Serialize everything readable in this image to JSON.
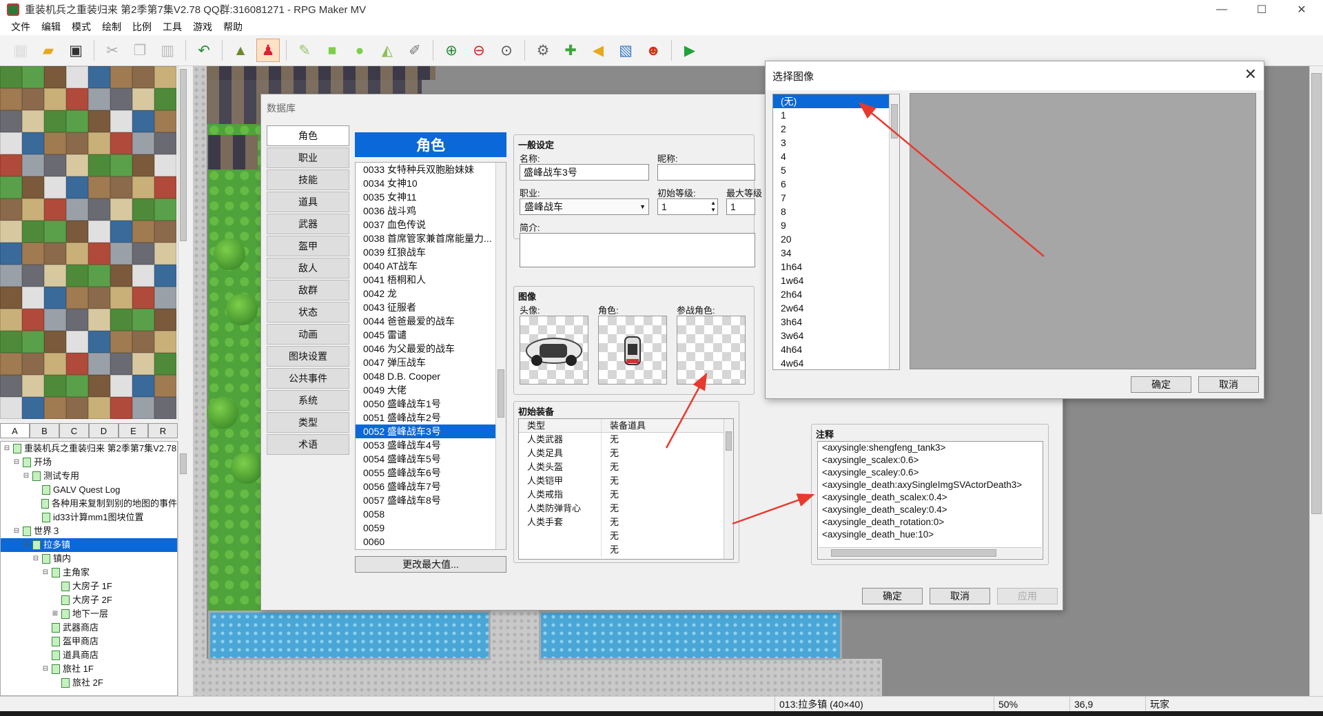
{
  "window": {
    "title": "重装机兵之重装归来 第2季第7集V2.78 QQ群:316081271 - RPG Maker MV"
  },
  "menu": [
    "文件",
    "编辑",
    "模式",
    "绘制",
    "比例",
    "工具",
    "游戏",
    "帮助"
  ],
  "toolbar": {
    "icons": [
      "new-file-icon",
      "open-folder-icon",
      "save-icon",
      "cut-icon",
      "copy-icon",
      "paste-icon",
      "undo-icon",
      "map-layer-icon",
      "event-layer-icon",
      "pencil-icon",
      "rectangle-icon",
      "ellipse-icon",
      "fill-icon",
      "shadow-pen-icon",
      "zoom-in-icon",
      "zoom-out-icon",
      "zoom-actual-icon",
      "database-icon",
      "plugin-icon",
      "sound-icon",
      "resource-icon",
      "character-generator-icon",
      "playtest-icon"
    ]
  },
  "tile_tabs": [
    "A",
    "B",
    "C",
    "D",
    "E",
    "R"
  ],
  "map_tree": [
    {
      "label": "重装机兵之重装归来 第2季第7集V2.78",
      "indent": 0,
      "exp": "⊟"
    },
    {
      "label": "开场",
      "indent": 1,
      "exp": "⊟"
    },
    {
      "label": "测试专用",
      "indent": 2,
      "exp": "⊟"
    },
    {
      "label": "GALV Quest Log",
      "indent": 3,
      "exp": ""
    },
    {
      "label": "各种用来复制到别的地图的事件",
      "indent": 3,
      "exp": ""
    },
    {
      "label": "id33计算mm1图块位置",
      "indent": 3,
      "exp": ""
    },
    {
      "label": "世界３",
      "indent": 1,
      "exp": "⊟"
    },
    {
      "label": "拉多镇",
      "indent": 2,
      "exp": "⊟",
      "selected": true
    },
    {
      "label": "镇内",
      "indent": 3,
      "exp": "⊟"
    },
    {
      "label": "主角家",
      "indent": 4,
      "exp": "⊟"
    },
    {
      "label": "大房子 1F",
      "indent": 5,
      "exp": ""
    },
    {
      "label": "大房子 2F",
      "indent": 5,
      "exp": ""
    },
    {
      "label": "地下一层",
      "indent": 5,
      "exp": "⊞"
    },
    {
      "label": "武器商店",
      "indent": 4,
      "exp": ""
    },
    {
      "label": "盔甲商店",
      "indent": 4,
      "exp": ""
    },
    {
      "label": "道具商店",
      "indent": 4,
      "exp": ""
    },
    {
      "label": "旅社 1F",
      "indent": 4,
      "exp": "⊟"
    },
    {
      "label": "旅社 2F",
      "indent": 5,
      "exp": ""
    }
  ],
  "database": {
    "title": "数据库",
    "categories": [
      "角色",
      "职业",
      "技能",
      "道具",
      "武器",
      "盔甲",
      "敌人",
      "敌群",
      "状态",
      "动画",
      "图块设置",
      "公共事件",
      "系统",
      "类型",
      "术语"
    ],
    "list_header": "角色",
    "actors": [
      {
        "label": "0033 女特种兵双胞胎妹妹"
      },
      {
        "label": "0034 女神10"
      },
      {
        "label": "0035 女神11"
      },
      {
        "label": "0036 战斗鸡"
      },
      {
        "label": "0037 血色传说"
      },
      {
        "label": "0038 首席管家兼首席能量力..."
      },
      {
        "label": "0039 红狼战车"
      },
      {
        "label": "0040 AT战车"
      },
      {
        "label": "0041 梧桐和人"
      },
      {
        "label": "0042 龙"
      },
      {
        "label": "0043 征服者"
      },
      {
        "label": "0044 爸爸最爱的战车"
      },
      {
        "label": "0045 雷谴"
      },
      {
        "label": "0046 为父最爱的战车"
      },
      {
        "label": "0047 弹压战车"
      },
      {
        "label": "0048 D.B. Cooper"
      },
      {
        "label": "0049 大佬"
      },
      {
        "label": "0050 盛峰战车1号"
      },
      {
        "label": "0051 盛峰战车2号"
      },
      {
        "label": "0052 盛峰战车3号",
        "selected": true
      },
      {
        "label": "0053 盛峰战车4号"
      },
      {
        "label": "0054 盛峰战车5号"
      },
      {
        "label": "0055 盛峰战车6号"
      },
      {
        "label": "0056 盛峰战车7号"
      },
      {
        "label": "0057 盛峰战车8号"
      },
      {
        "label": "0058"
      },
      {
        "label": "0059"
      },
      {
        "label": "0060"
      }
    ],
    "change_max": "更改最大值...",
    "general": {
      "title": "一般设定",
      "name_label": "名称:",
      "name_value": "盛峰战车3号",
      "nick_label": "昵称:",
      "nick_value": "",
      "class_label": "职业:",
      "class_value": "盛峰战车",
      "init_level_label": "初始等级:",
      "init_level_value": "1",
      "max_level_label": "最大等级",
      "max_level_value": "1",
      "profile_label": "简介:"
    },
    "images": {
      "title": "图像",
      "face_label": "头像:",
      "char_label": "角色:",
      "battler_label": "参战角色:"
    },
    "equip": {
      "title": "初始装备",
      "col_type": "类型",
      "col_item": "装备道具",
      "rows": [
        {
          "type": "人类武器",
          "item": "无"
        },
        {
          "type": "人类足具",
          "item": "无"
        },
        {
          "type": "人类头盔",
          "item": "无"
        },
        {
          "type": "人类铠甲",
          "item": "无"
        },
        {
          "type": "人类戒指",
          "item": "无"
        },
        {
          "type": "人类防弹背心",
          "item": "无"
        },
        {
          "type": "人类手套",
          "item": "无"
        },
        {
          "type": "",
          "item": "无"
        },
        {
          "type": "",
          "item": "无"
        }
      ]
    },
    "note": {
      "title": "注释",
      "lines": [
        "<axysingle:shengfeng_tank3>",
        "<axysingle_scalex:0.6>",
        "<axysingle_scaley:0.6>",
        "<axysingle_death:axySingleImgSVActorDeath3>",
        "<axysingle_death_scalex:0.4>",
        "<axysingle_death_scaley:0.4>",
        "<axysingle_death_rotation:0>",
        "<axysingle_death_hue:10>"
      ]
    },
    "buttons": {
      "ok": "确定",
      "cancel": "取消",
      "apply": "应用"
    }
  },
  "select_image": {
    "title": "选择图像",
    "files": [
      {
        "label": "(无)",
        "selected": true
      },
      {
        "label": "1"
      },
      {
        "label": "2"
      },
      {
        "label": "3"
      },
      {
        "label": "4"
      },
      {
        "label": "5"
      },
      {
        "label": "6"
      },
      {
        "label": "7"
      },
      {
        "label": "8"
      },
      {
        "label": "9"
      },
      {
        "label": "20"
      },
      {
        "label": "34"
      },
      {
        "label": "1h64"
      },
      {
        "label": "1w64"
      },
      {
        "label": "2h64"
      },
      {
        "label": "2w64"
      },
      {
        "label": "3h64"
      },
      {
        "label": "3w64"
      },
      {
        "label": "4h64"
      },
      {
        "label": "4w64"
      }
    ],
    "ok": "确定",
    "cancel": "取消"
  },
  "status": {
    "map": "013:拉多镇 (40×40)",
    "zoom": "50%",
    "coord": "36,9",
    "layer": "玩家"
  },
  "colors": {
    "accent": "#0b68d8",
    "arrow": "#e8392e"
  }
}
